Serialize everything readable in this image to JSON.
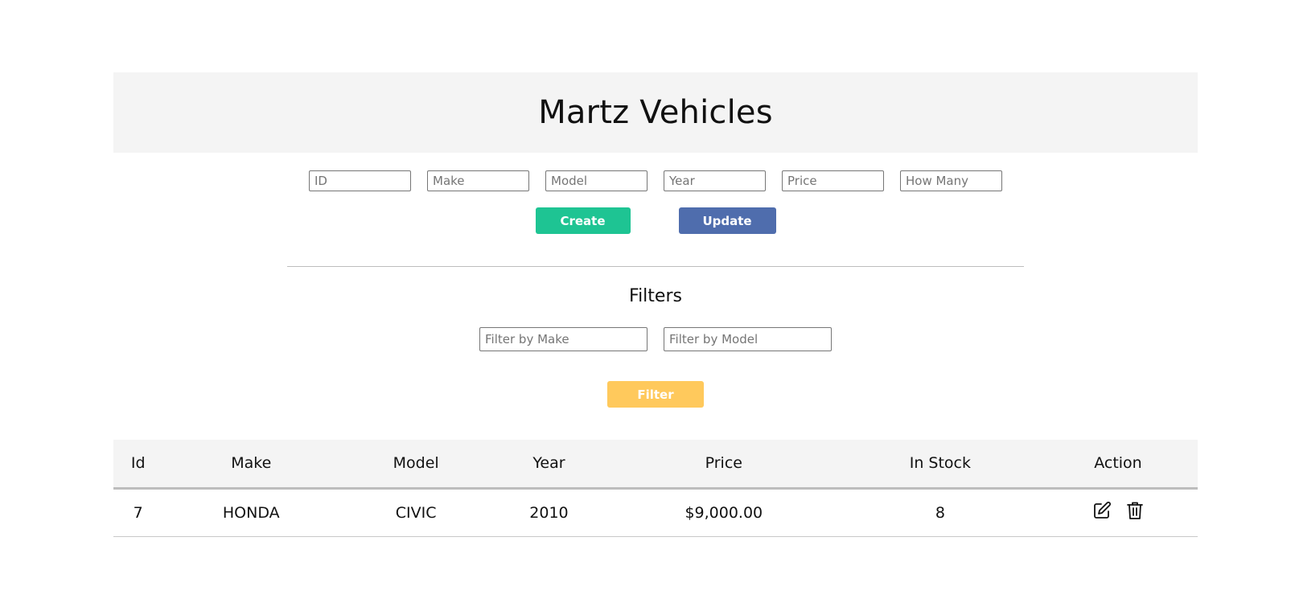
{
  "header": {
    "title": "Martz Vehicles"
  },
  "form": {
    "id_placeholder": "ID",
    "make_placeholder": "Make",
    "model_placeholder": "Model",
    "year_placeholder": "Year",
    "price_placeholder": "Price",
    "how_many_placeholder": "How Many",
    "create_label": "Create",
    "update_label": "Update"
  },
  "filters": {
    "title": "Filters",
    "make_placeholder": "Filter by Make",
    "model_placeholder": "Filter by Model",
    "filter_label": "Filter"
  },
  "table": {
    "headers": [
      "Id",
      "Make",
      "Model",
      "Year",
      "Price",
      "In Stock",
      "Action"
    ],
    "rows": [
      {
        "id": "7",
        "make": "HONDA",
        "model": "CIVIC",
        "year": "2010",
        "price": "$9,000.00",
        "in_stock": "8",
        "actions": [
          "edit-icon",
          "trash-icon"
        ]
      }
    ]
  },
  "colors": {
    "create": "#1ec493",
    "update": "#4f6dad",
    "filter": "#ffc95c",
    "header_bg": "#f4f4f4"
  }
}
